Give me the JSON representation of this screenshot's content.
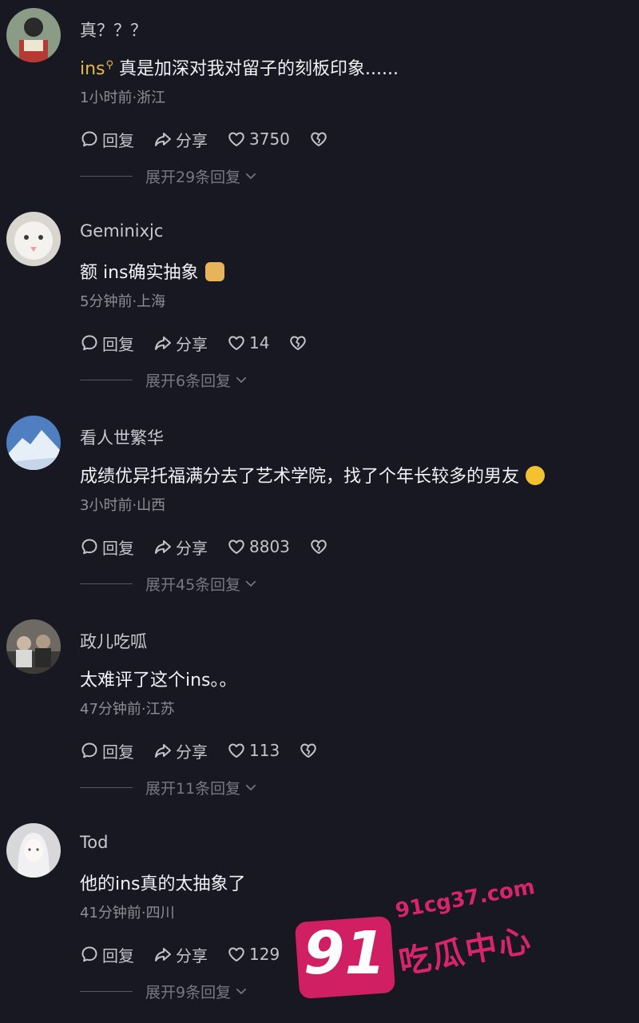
{
  "comments": [
    {
      "username": "真？？？",
      "avatar": "avatar-person-reading",
      "link_text": "ins",
      "text": " 真是加深对我对留子的刻板印象......",
      "meta": "1小时前·浙江",
      "reply_label": "回复",
      "share_label": "分享",
      "likes": "3750",
      "expand": "展开29条回复"
    },
    {
      "username": "Geminixjc",
      "avatar": "avatar-white-cat",
      "text": "额 ins确实抽象",
      "emoji": "cat-face",
      "meta": "5分钟前·上海",
      "reply_label": "回复",
      "share_label": "分享",
      "likes": "14",
      "expand": "展开6条回复"
    },
    {
      "username": "看人世繁华",
      "avatar": "avatar-snow-mountain",
      "text": "成绩优异托福满分去了艺术学院，找了个年长较多的男友",
      "emoji": "smile-face",
      "meta": "3小时前·山西",
      "reply_label": "回复",
      "share_label": "分享",
      "likes": "8803",
      "expand": "展开45条回复"
    },
    {
      "username": "政儿吃呱",
      "avatar": "avatar-group-photo",
      "text": "太难评了这个ins。。",
      "meta": "47分钟前·江苏",
      "reply_label": "回复",
      "share_label": "分享",
      "likes": "113",
      "expand": "展开11条回复"
    },
    {
      "username": "Tod",
      "avatar": "avatar-anime-girl",
      "text": "他的ins真的太抽象了",
      "meta": "41分钟前·四川",
      "reply_label": "回复",
      "share_label": "分享",
      "likes": "129",
      "expand": "展开9条回复"
    }
  ],
  "watermark": {
    "number": "91",
    "url": "91cg37.com",
    "name": "吃瓜中心"
  }
}
